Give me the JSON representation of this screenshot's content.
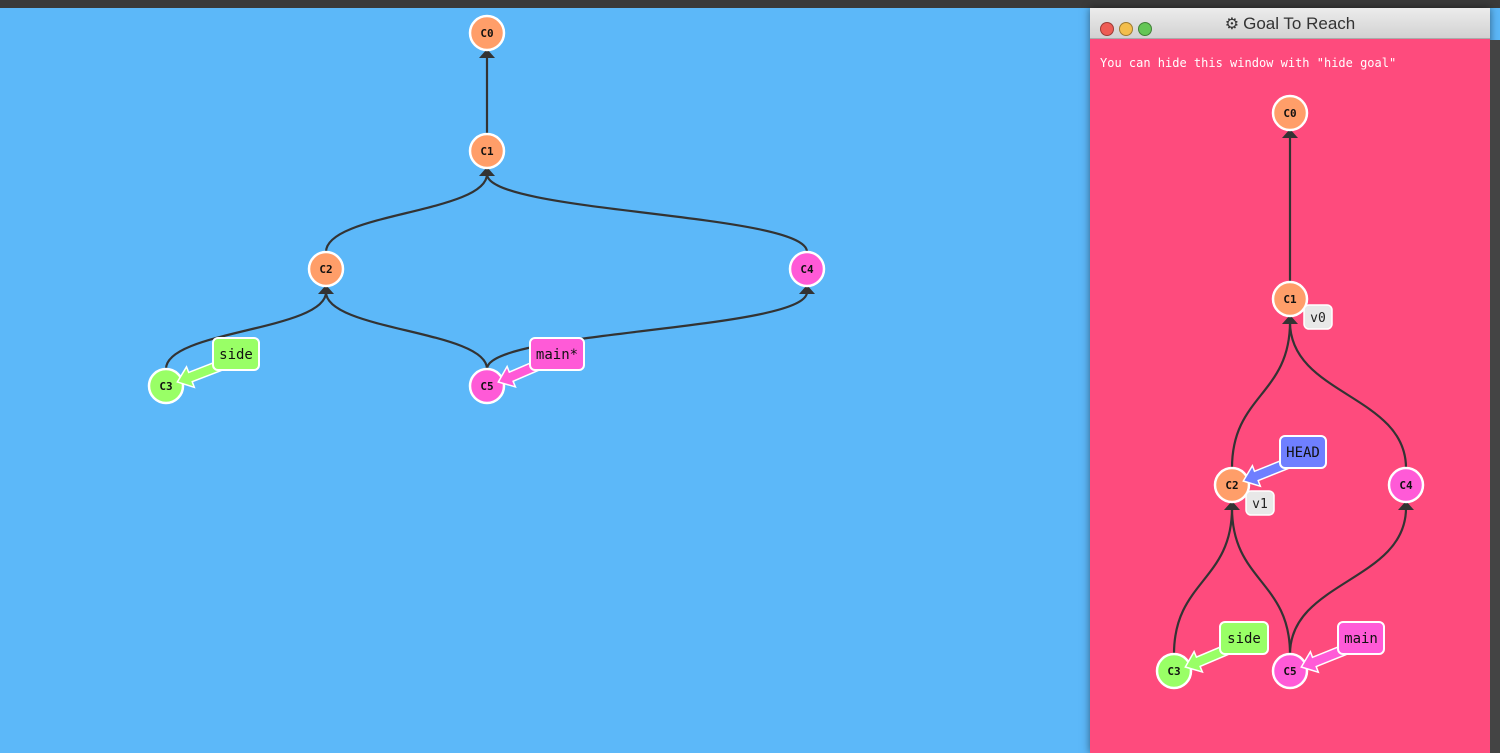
{
  "colors": {
    "background": "#5cb8f9",
    "goal_background": "#fe4b7d",
    "commit_orange": "#ff9e69",
    "commit_magenta": "#ff5ad7",
    "commit_green": "#99ff66",
    "branch_side": "#99ff66",
    "branch_main": "#ff5ad7",
    "branch_head": "#6f7fff",
    "tag": "#e8e8e8",
    "edge": "#333333"
  },
  "main_tree": {
    "commits": [
      {
        "id": "C0",
        "color": "orange"
      },
      {
        "id": "C1",
        "color": "orange"
      },
      {
        "id": "C2",
        "color": "orange"
      },
      {
        "id": "C4",
        "color": "magenta"
      },
      {
        "id": "C3",
        "color": "green"
      },
      {
        "id": "C5",
        "color": "magenta"
      }
    ],
    "edges": [
      [
        "C1",
        "C0"
      ],
      [
        "C2",
        "C1"
      ],
      [
        "C4",
        "C1"
      ],
      [
        "C3",
        "C2"
      ],
      [
        "C5",
        "C2"
      ],
      [
        "C5",
        "C4"
      ]
    ],
    "branches": [
      {
        "name": "side",
        "target": "C3",
        "color": "green"
      },
      {
        "name": "main*",
        "target": "C5",
        "color": "magenta"
      }
    ]
  },
  "goal": {
    "icon": "gear-icon",
    "title": "Goal To Reach",
    "hint": "You can hide this window with \"hide goal\"",
    "commits": [
      {
        "id": "C0",
        "color": "orange"
      },
      {
        "id": "C1",
        "color": "orange"
      },
      {
        "id": "C2",
        "color": "orange"
      },
      {
        "id": "C4",
        "color": "magenta"
      },
      {
        "id": "C3",
        "color": "green"
      },
      {
        "id": "C5",
        "color": "magenta"
      }
    ],
    "edges": [
      [
        "C1",
        "C0"
      ],
      [
        "C2",
        "C1"
      ],
      [
        "C4",
        "C1"
      ],
      [
        "C3",
        "C2"
      ],
      [
        "C5",
        "C2"
      ],
      [
        "C5",
        "C4"
      ]
    ],
    "branches": [
      {
        "name": "HEAD",
        "target": "C2",
        "color": "head"
      },
      {
        "name": "side",
        "target": "C3",
        "color": "green"
      },
      {
        "name": "main",
        "target": "C5",
        "color": "magenta"
      }
    ],
    "tags": [
      {
        "name": "v0",
        "target": "C1"
      },
      {
        "name": "v1",
        "target": "C2"
      }
    ]
  }
}
